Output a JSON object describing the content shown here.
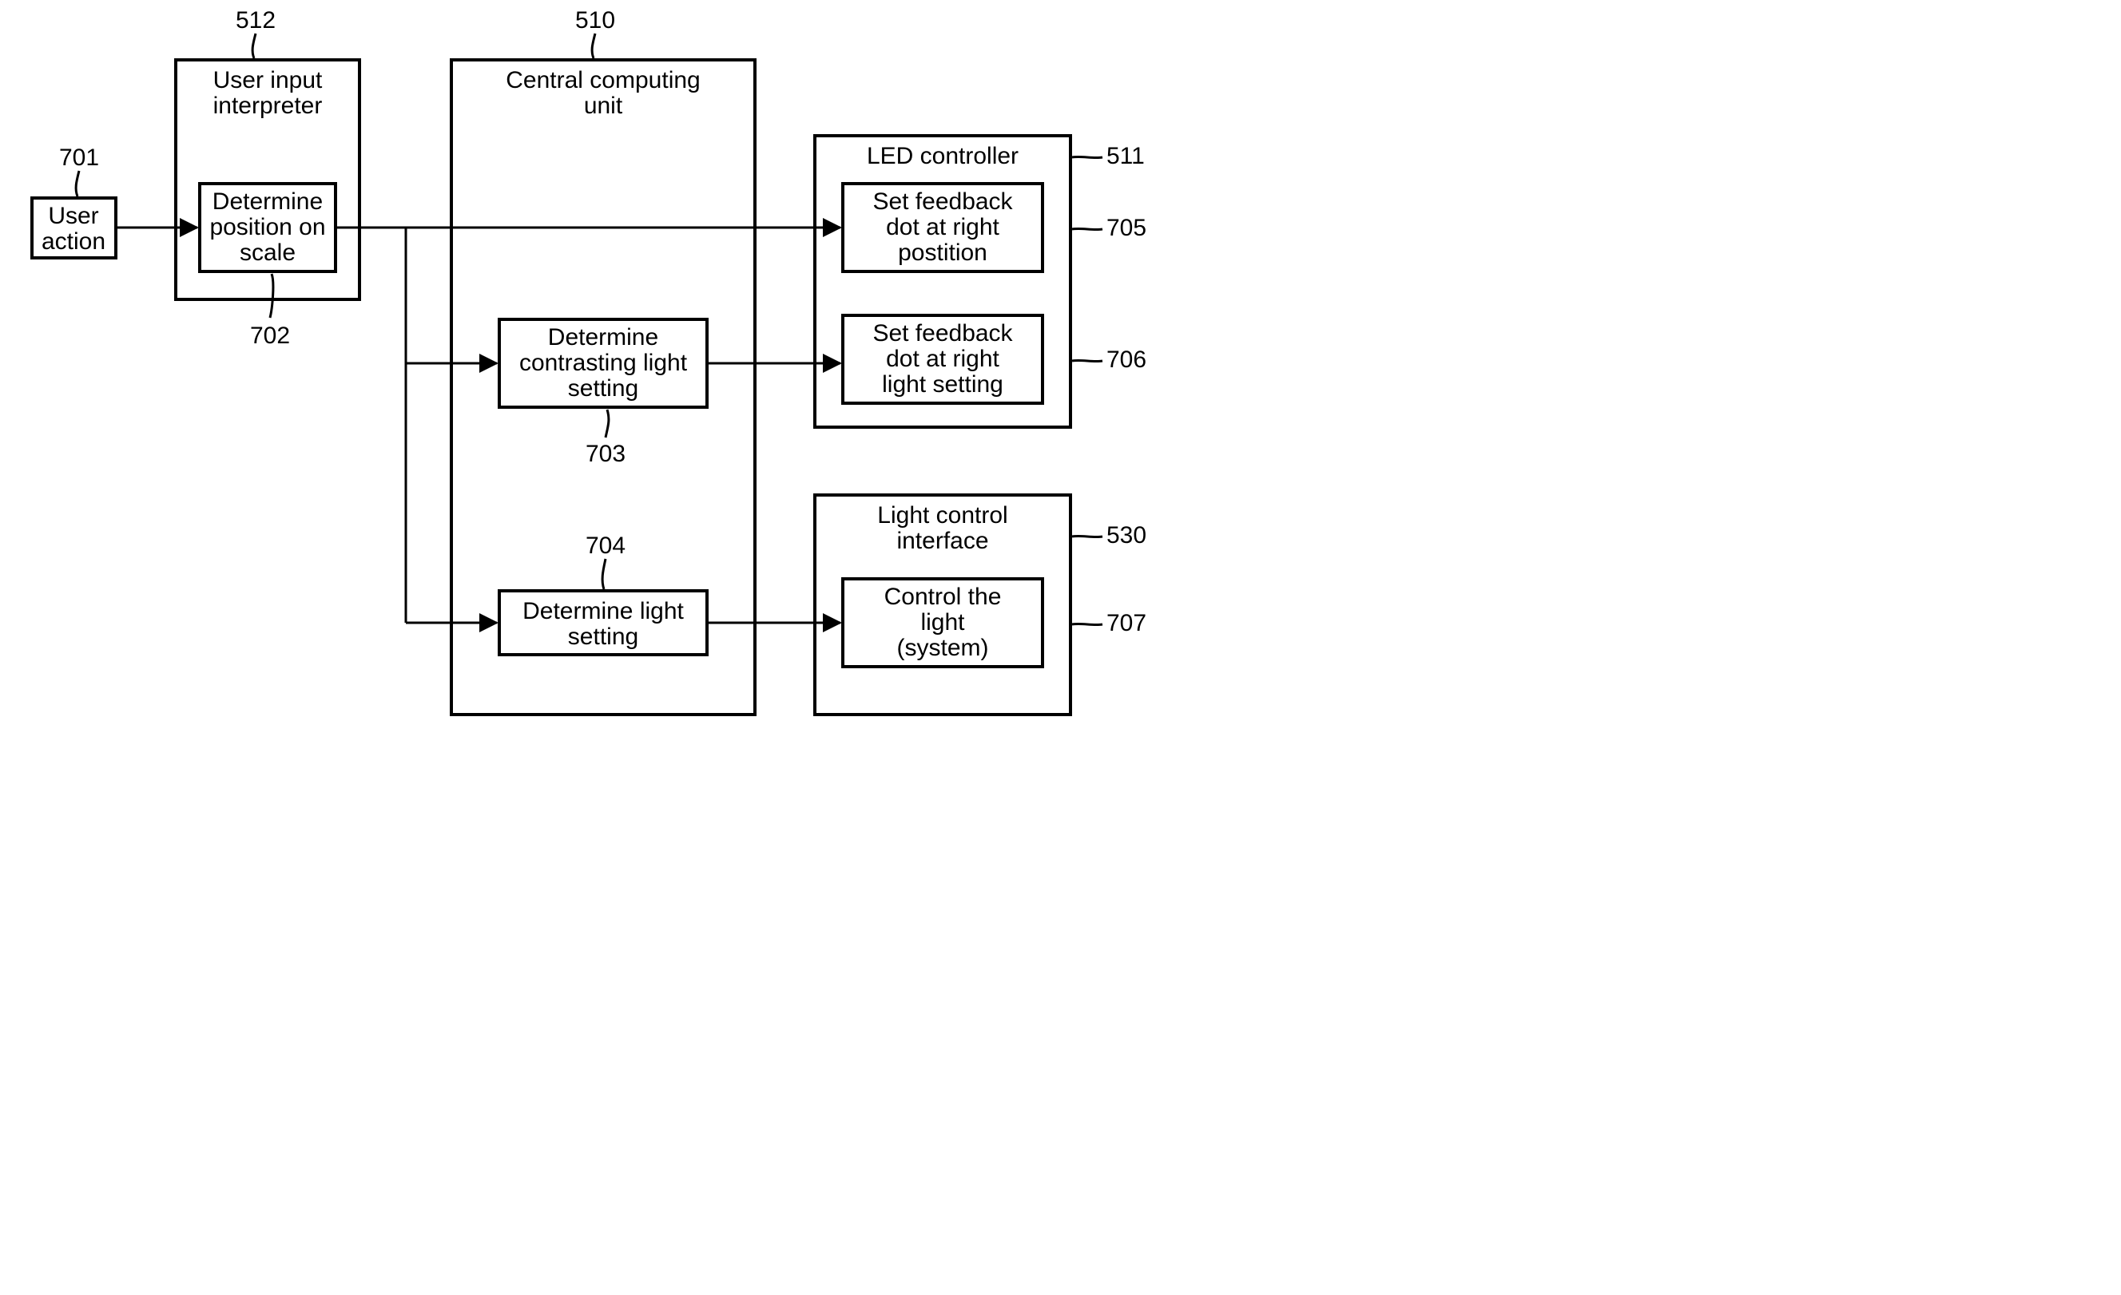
{
  "refs": {
    "n701": "701",
    "n702": "702",
    "n512": "512",
    "n510": "510",
    "n703": "703",
    "n704": "704",
    "n511": "511",
    "n705": "705",
    "n706": "706",
    "n530": "530",
    "n707": "707"
  },
  "blocks": {
    "user_action_l1": "User",
    "user_action_l2": "action",
    "uii_title_l1": "User input",
    "uii_title_l2": "interpreter",
    "b702_l1": "Determine",
    "b702_l2": "position on",
    "b702_l3": "scale",
    "ccu_title_l1": "Central computing",
    "ccu_title_l2": "unit",
    "b703_l1": "Determine",
    "b703_l2": "contrasting light",
    "b703_l3": "setting",
    "b704_l1": "Determine light",
    "b704_l2": "setting",
    "led_title": "LED controller",
    "b705_l1": "Set feedback",
    "b705_l2": "dot at right",
    "b705_l3": "postition",
    "b706_l1": "Set feedback",
    "b706_l2": "dot at right",
    "b706_l3": "light setting",
    "lci_title_l1": "Light control",
    "lci_title_l2": "interface",
    "b707_l1": "Control the",
    "b707_l2": "light",
    "b707_l3": "(system)"
  }
}
